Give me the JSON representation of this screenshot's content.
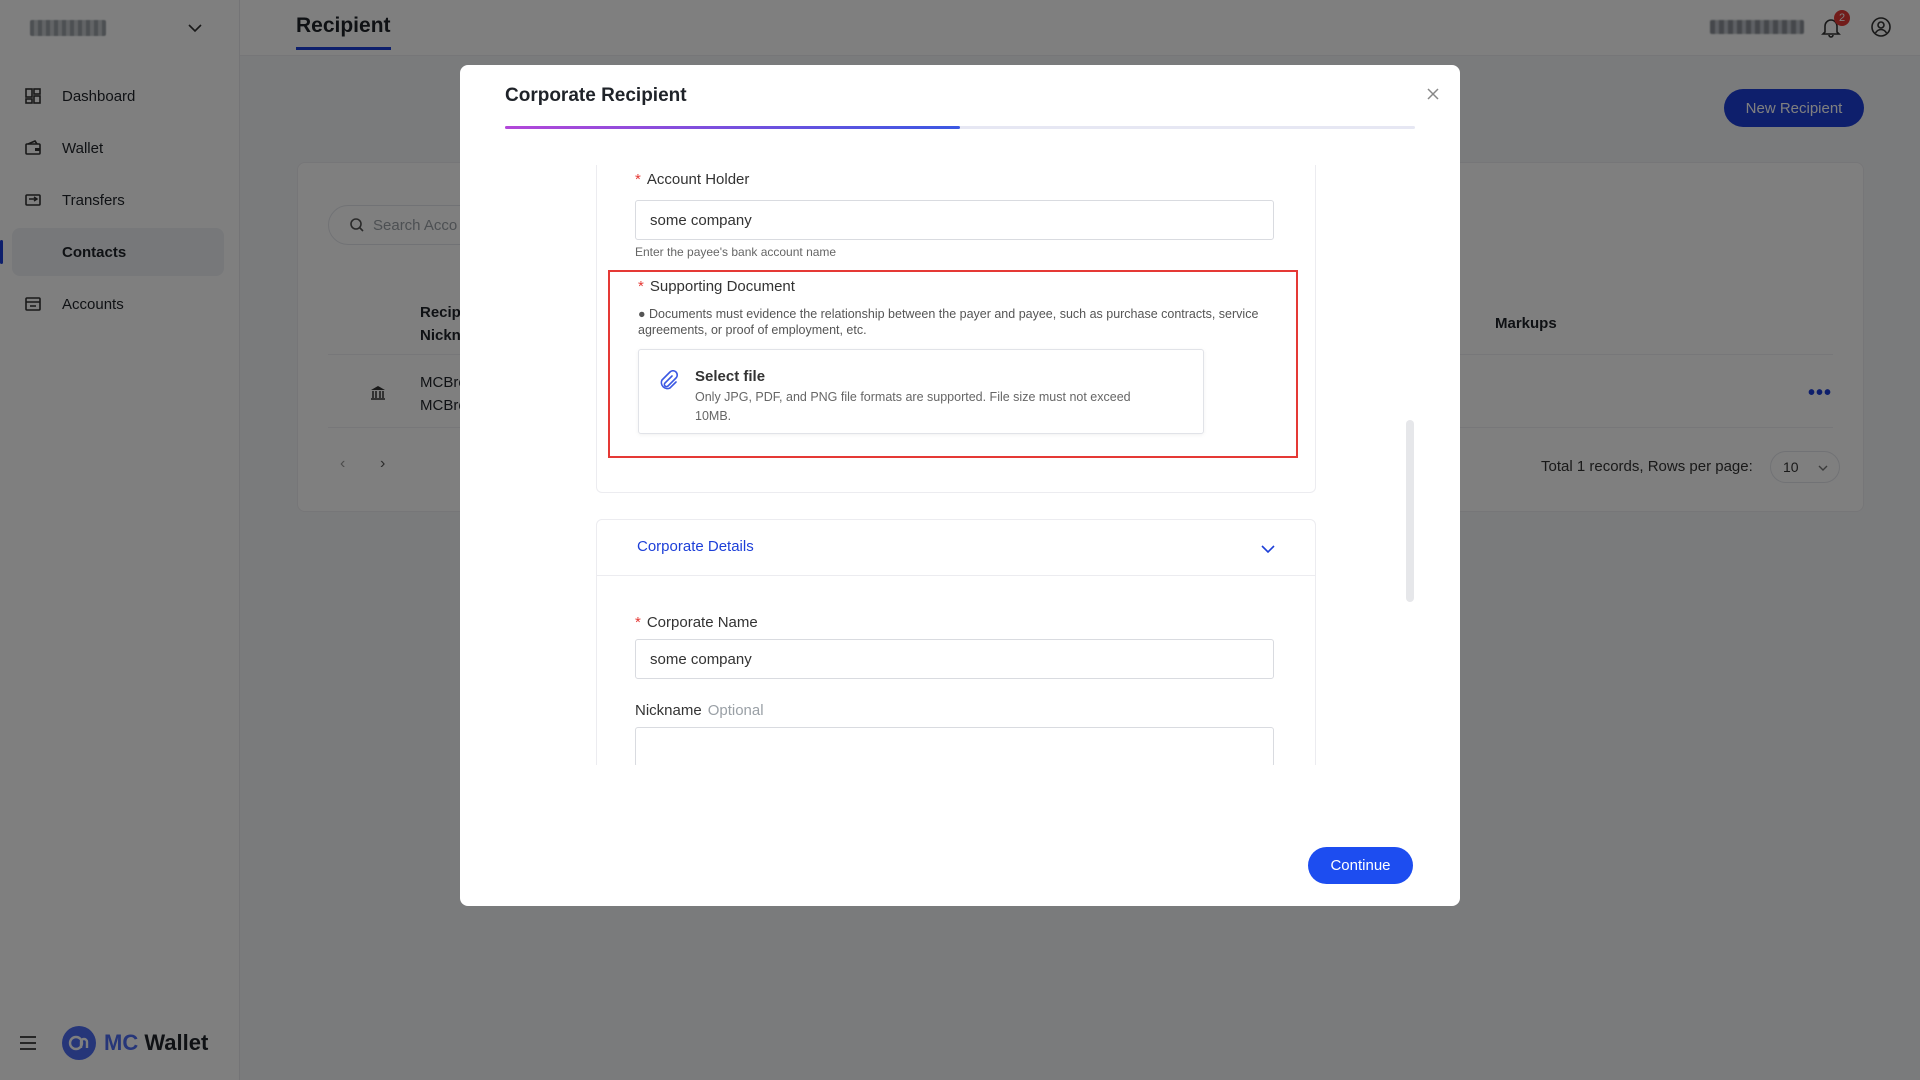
{
  "sidebar": {
    "nav": [
      {
        "label": "Dashboard",
        "icon": "dashboard-icon"
      },
      {
        "label": "Wallet",
        "icon": "wallet-icon"
      },
      {
        "label": "Transfers",
        "icon": "transfers-icon"
      },
      {
        "label": "Contacts",
        "icon": "contacts-icon",
        "active": true
      },
      {
        "label": "Accounts",
        "icon": "accounts-icon"
      }
    ],
    "logo": {
      "mc": "MC",
      "wallet": "Wallet"
    }
  },
  "header": {
    "title": "Recipient",
    "notification_count": "2"
  },
  "main": {
    "new_recipient_label": "New Recipient",
    "search_placeholder": "Search Acco",
    "columns": {
      "recipient": "Recip",
      "recipient_line2": "Nickn",
      "markups": "Markups"
    },
    "row": {
      "name_line1": "MCBre",
      "name_line2": "MCBre",
      "more": "•••"
    },
    "total_text": "Total 1 records, Rows per page:",
    "rows_per_page": "10"
  },
  "modal": {
    "title": "Corporate Recipient",
    "progress_fraction": 0.5,
    "account_holder": {
      "label": "Account Holder",
      "value": "some company",
      "hint": "Enter the payee's bank account name"
    },
    "supporting_document": {
      "label": "Supporting Document",
      "description": "● Documents must evidence the relationship between the payer and payee, such as purchase contracts, service agreements, or proof of employment, etc.",
      "select_title": "Select file",
      "select_hint": "Only JPG, PDF, and PNG file formats are supported. File size must not exceed 10MB."
    },
    "corporate_details": {
      "section_title": "Corporate Details",
      "corporate_name_label": "Corporate Name",
      "corporate_name_value": "some company",
      "nickname_label": "Nickname",
      "nickname_optional": "Optional",
      "nickname_value": ""
    },
    "continue_label": "Continue"
  },
  "colors": {
    "primary": "#1d3fd8",
    "required": "#e53935",
    "progress_start": "#b347d9",
    "progress_end": "#3b58e3"
  }
}
